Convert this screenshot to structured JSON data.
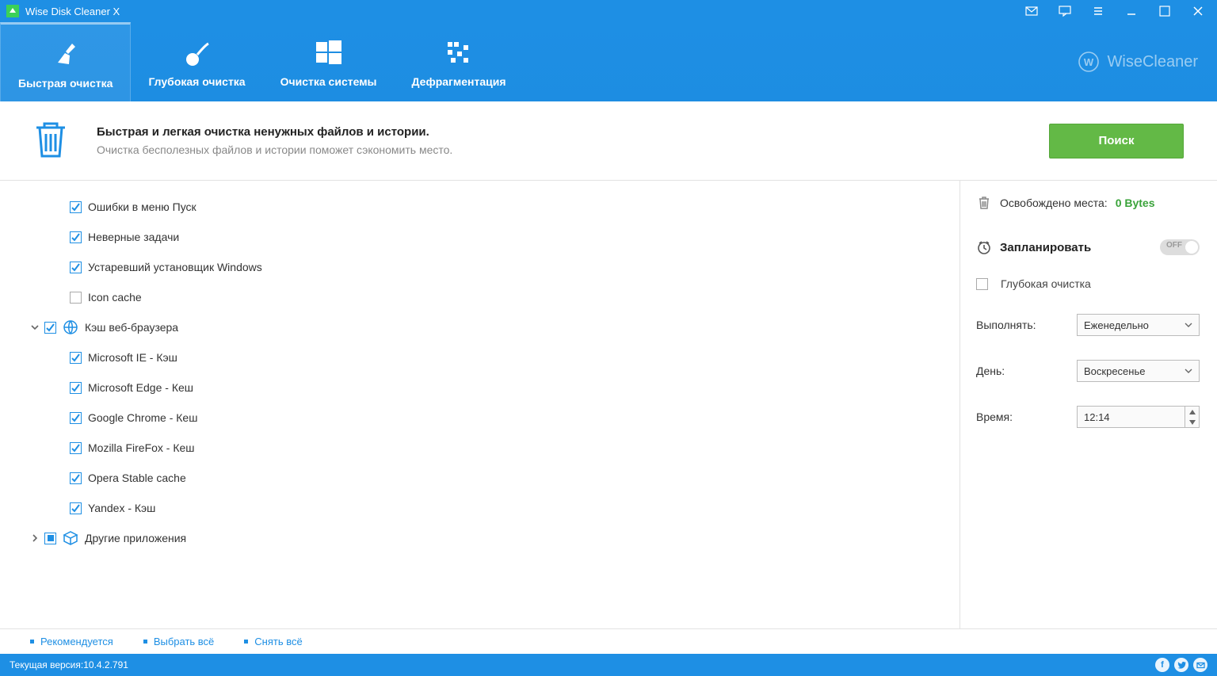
{
  "titlebar": {
    "title": "Wise Disk Cleaner X"
  },
  "tabs": [
    {
      "label": "Быстрая очистка"
    },
    {
      "label": "Глубокая очистка"
    },
    {
      "label": "Очистка системы"
    },
    {
      "label": "Дефрагментация"
    }
  ],
  "brand": "WiseCleaner",
  "header": {
    "title": "Быстрая и легкая очистка ненужных файлов и истории.",
    "subtitle": "Очистка бесполезных файлов и истории поможет сэкономить место.",
    "scan": "Поиск"
  },
  "items": [
    {
      "type": "item",
      "checked": true,
      "label": "Ошибки в меню Пуск"
    },
    {
      "type": "item",
      "checked": true,
      "label": "Неверные задачи"
    },
    {
      "type": "item",
      "checked": true,
      "label": "Устаревший установщик Windows"
    },
    {
      "type": "item",
      "checked": false,
      "label": "Icon cache"
    },
    {
      "type": "group",
      "expanded": true,
      "checked": true,
      "icon": "globe",
      "label": "Кэш веб-браузера"
    },
    {
      "type": "item",
      "checked": true,
      "label": "Microsoft IE - Кэш"
    },
    {
      "type": "item",
      "checked": true,
      "label": "Microsoft Edge - Кеш"
    },
    {
      "type": "item",
      "checked": true,
      "label": "Google Chrome - Кеш"
    },
    {
      "type": "item",
      "checked": true,
      "label": "Mozilla FireFox - Кеш"
    },
    {
      "type": "item",
      "checked": true,
      "label": "Opera Stable cache"
    },
    {
      "type": "item",
      "checked": true,
      "label": "Yandex - Кэш"
    },
    {
      "type": "group",
      "expanded": false,
      "checked": "indet",
      "icon": "box",
      "label": "Другие приложения"
    }
  ],
  "side": {
    "freed_label": "Освобождено места:",
    "freed_value": "0 Bytes",
    "schedule": "Запланировать",
    "toggle": "OFF",
    "deep": "Глубокая очистка",
    "run_label": "Выполнять:",
    "run_value": "Еженедельно",
    "day_label": "День:",
    "day_value": "Воскресенье",
    "time_label": "Время:",
    "time_value": "12:14"
  },
  "footer_links": [
    "Рекомендуется",
    "Выбрать всё",
    "Снять всё"
  ],
  "version_label": "Текущая версия:",
  "version": "10.4.2.791"
}
